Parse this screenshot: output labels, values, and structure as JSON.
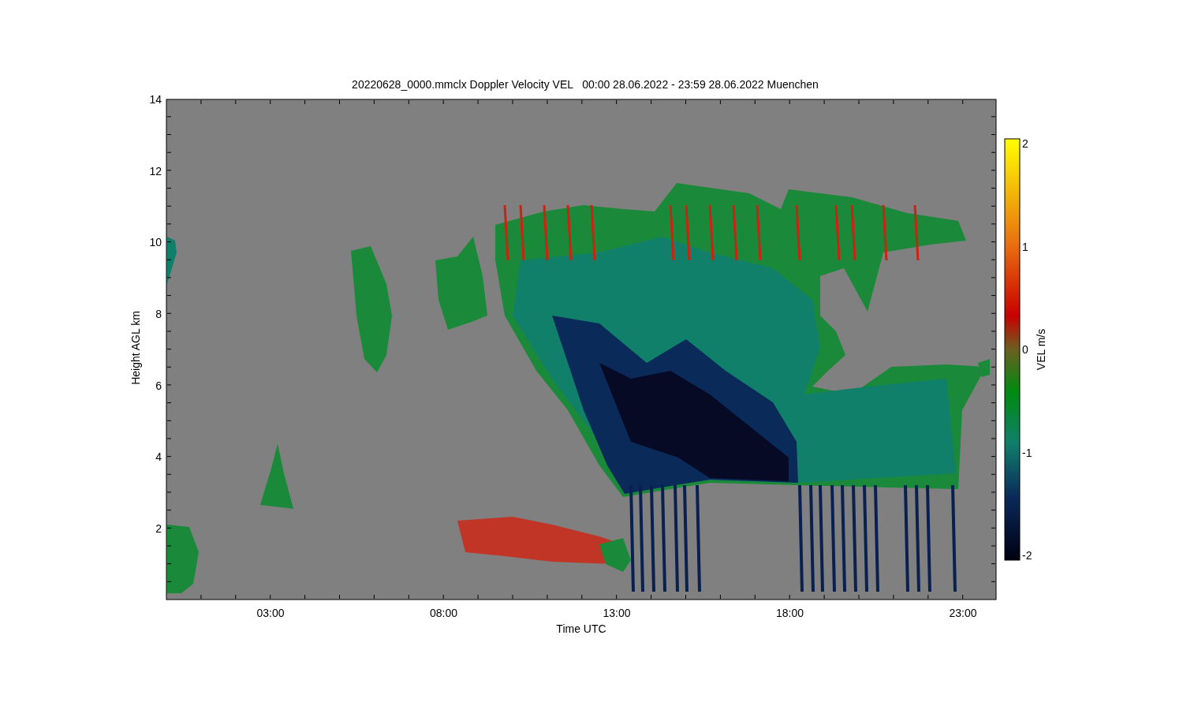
{
  "title": "20220628_0000.mmclx Doppler Velocity VEL   00:00 28.06.2022 - 23:59 28.06.2022 Muenchen",
  "y_axis": {
    "label": "Height AGL km",
    "ticks": [
      "14",
      "12",
      "10",
      "8",
      "6",
      "4",
      "2"
    ]
  },
  "x_axis": {
    "label": "Time UTC",
    "ticks": [
      "03:00",
      "08:00",
      "13:00",
      "18:00",
      "23:00"
    ]
  },
  "colorbar": {
    "label": "VEL m/s",
    "ticks": [
      "2",
      "1",
      "0",
      "-1",
      "-2"
    ]
  }
}
